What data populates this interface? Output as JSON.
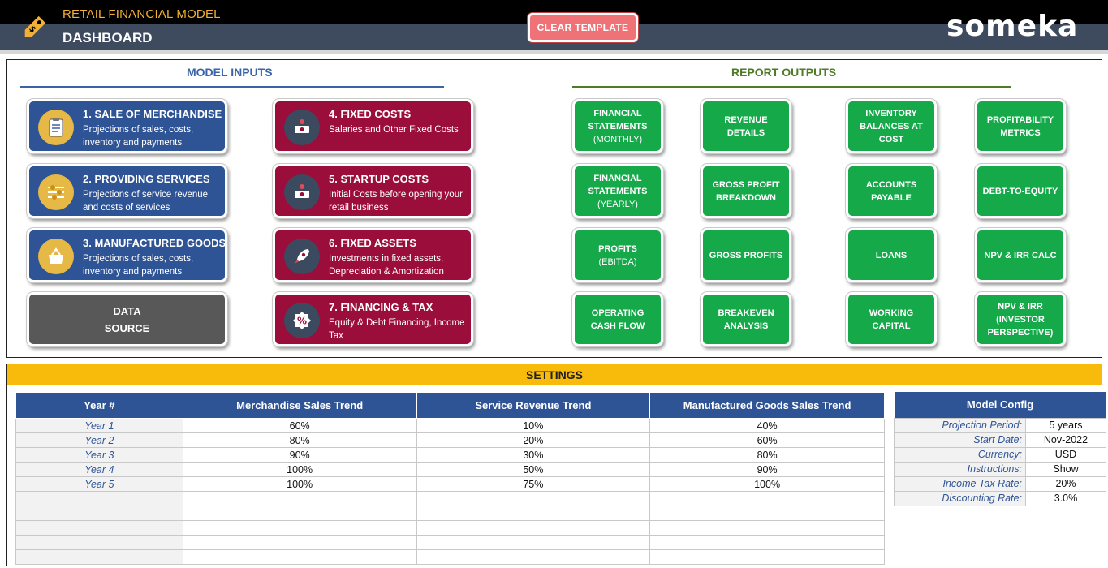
{
  "header": {
    "app_title": "RETAIL FINANCIAL MODEL",
    "page_title": "DASHBOARD",
    "clear_button": "CLEAR TEMPLATE",
    "brand": "someka",
    "icons": [
      "price-tag-icon"
    ],
    "colors": {
      "title": "#f2b134",
      "clear_button": "#ef7376"
    }
  },
  "inputs": {
    "title": "MODEL INPUTS",
    "cards": [
      {
        "title": "1. SALE OF MERCHANDISE",
        "desc": "Projections of sales, costs, inventory and payments",
        "icon": "clipboard-checklist-icon",
        "color": "#2f5496"
      },
      {
        "title": "2. PROVIDING SERVICES",
        "desc": "Projections of service revenue and costs of services",
        "icon": "sliders-icon",
        "color": "#2f5496"
      },
      {
        "title": "3. MANUFACTURED GOODS",
        "desc": "Projections of sales, costs, inventory and payments",
        "icon": "basket-icon",
        "color": "#2f5496"
      },
      {
        "title": "4. FIXED COSTS",
        "desc": "Salaries and Other Fixed Costs",
        "icon": "money-stack-icon",
        "color": "#9b0d3a"
      },
      {
        "title": "5. STARTUP COSTS",
        "desc": "Initial Costs before opening your retail business",
        "icon": "money-stack-icon",
        "color": "#9b0d3a"
      },
      {
        "title": "6. FIXED ASSETS",
        "desc": "Investments in fixed assets, Depreciation & Amortization",
        "icon": "rocket-icon",
        "color": "#9b0d3a"
      },
      {
        "title": "7. FINANCING & TAX",
        "desc": "Equity & Debt Financing, Income Tax",
        "icon": "percent-badge-icon",
        "color": "#9b0d3a"
      }
    ],
    "data_source": {
      "line1": "DATA",
      "line2": "SOURCE"
    }
  },
  "outputs": {
    "title": "REPORT OUTPUTS",
    "color": "#15a94a",
    "buttons": [
      {
        "label": "FINANCIAL STATEMENTS",
        "sub": "(MONTHLY)"
      },
      {
        "label": "REVENUE DETAILS",
        "sub": ""
      },
      {
        "label": "INVENTORY BALANCES AT COST",
        "sub": ""
      },
      {
        "label": "PROFITABILITY METRICS",
        "sub": ""
      },
      {
        "label": "FINANCIAL STATEMENTS",
        "sub": "(YEARLY)"
      },
      {
        "label": "GROSS PROFIT BREAKDOWN",
        "sub": ""
      },
      {
        "label": "ACCOUNTS PAYABLE",
        "sub": ""
      },
      {
        "label": "DEBT-TO-EQUITY",
        "sub": ""
      },
      {
        "label": "PROFITS",
        "sub": "(EBITDA)"
      },
      {
        "label": "GROSS PROFITS",
        "sub": ""
      },
      {
        "label": "LOANS",
        "sub": ""
      },
      {
        "label": "NPV & IRR CALC",
        "sub": ""
      },
      {
        "label": "OPERATING CASH FLOW",
        "sub": ""
      },
      {
        "label": "BREAKEVEN ANALYSIS",
        "sub": ""
      },
      {
        "label": "WORKING CAPITAL",
        "sub": ""
      },
      {
        "label": "NPV & IRR (INVESTOR PERSPECTIVE)",
        "sub": ""
      }
    ]
  },
  "settings": {
    "title": "SETTINGS",
    "bar_color": "#f8bb0b",
    "trend_table": {
      "headers": [
        "Year #",
        "Merchandise Sales Trend",
        "Service Revenue Trend",
        "Manufactured Goods Sales Trend"
      ],
      "rows": [
        [
          "Year 1",
          "60%",
          "10%",
          "40%"
        ],
        [
          "Year 2",
          "80%",
          "20%",
          "60%"
        ],
        [
          "Year 3",
          "90%",
          "30%",
          "80%"
        ],
        [
          "Year 4",
          "100%",
          "50%",
          "90%"
        ],
        [
          "Year 5",
          "100%",
          "75%",
          "100%"
        ],
        [
          "",
          "",
          "",
          ""
        ],
        [
          "",
          "",
          "",
          ""
        ],
        [
          "",
          "",
          "",
          ""
        ],
        [
          "",
          "",
          "",
          ""
        ],
        [
          "",
          "",
          "",
          ""
        ]
      ]
    },
    "model_config": {
      "header": "Model Config",
      "rows": [
        [
          "Projection Period:",
          "5 years"
        ],
        [
          "Start Date:",
          "Nov-2022"
        ],
        [
          "Currency:",
          "USD"
        ],
        [
          "Instructions:",
          "Show"
        ],
        [
          "Income Tax Rate:",
          "20%"
        ],
        [
          "Discounting Rate:",
          "3.0%"
        ]
      ]
    }
  }
}
